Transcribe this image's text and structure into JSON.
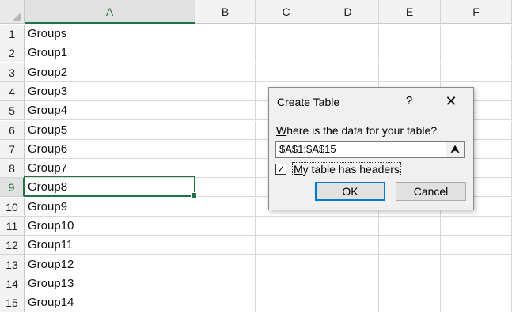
{
  "columns": [
    "A",
    "B",
    "C",
    "D",
    "E",
    "F"
  ],
  "selected_column": "A",
  "selected_row": "9",
  "rows": [
    {
      "num": "1",
      "a": "Groups"
    },
    {
      "num": "2",
      "a": "Group1"
    },
    {
      "num": "3",
      "a": "Group2"
    },
    {
      "num": "4",
      "a": "Group3"
    },
    {
      "num": "5",
      "a": "Group4"
    },
    {
      "num": "6",
      "a": "Group5"
    },
    {
      "num": "7",
      "a": "Group6"
    },
    {
      "num": "8",
      "a": "Group7"
    },
    {
      "num": "9",
      "a": "Group8"
    },
    {
      "num": "10",
      "a": "Group9"
    },
    {
      "num": "11",
      "a": "Group10"
    },
    {
      "num": "12",
      "a": "Group11"
    },
    {
      "num": "13",
      "a": "Group12"
    },
    {
      "num": "14",
      "a": "Group13"
    },
    {
      "num": "15",
      "a": "Group14"
    }
  ],
  "dialog": {
    "title": "Create Table",
    "help": "?",
    "close": "✕",
    "prompt_prefix": "W",
    "prompt_rest": "here is the data for your table?",
    "range_value": "$A$1:$A$15",
    "collapse_icon": "⮝",
    "checkbox_checked": true,
    "checkbox_mark": "✓",
    "checkbox_label_prefix": "M",
    "checkbox_label_rest": "y table has headers",
    "ok_label": "OK",
    "cancel_label": "Cancel"
  },
  "colors": {
    "accent": "#217346",
    "focus": "#0078d7"
  }
}
